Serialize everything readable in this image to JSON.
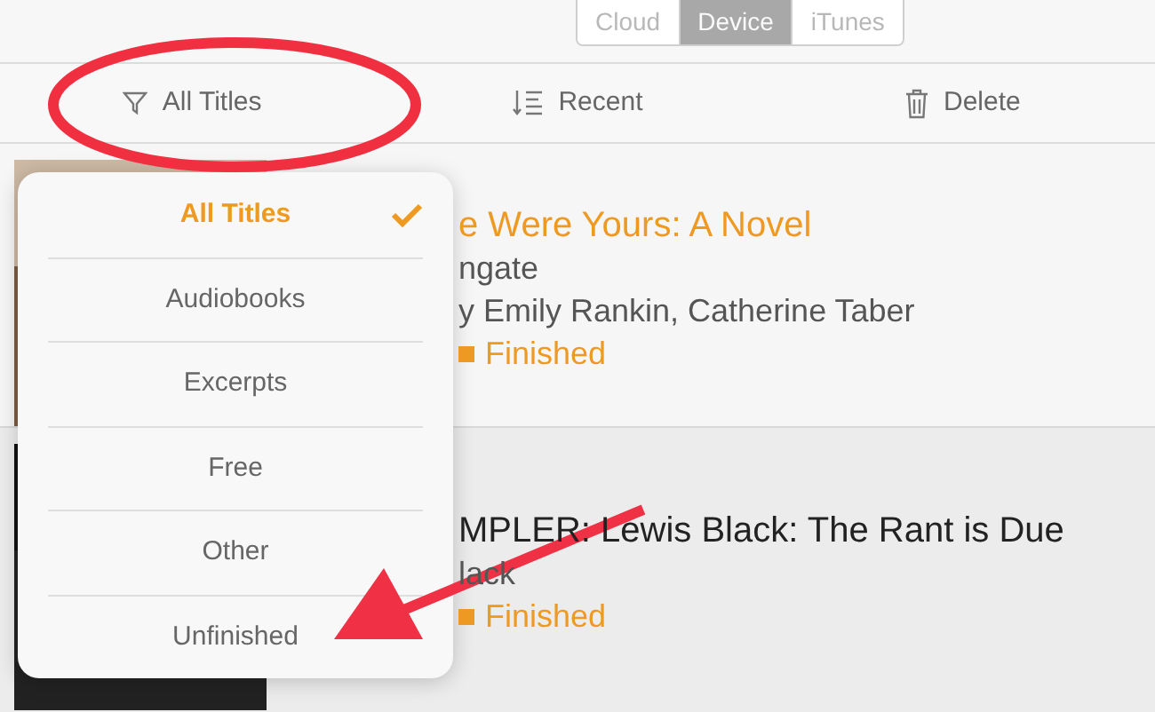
{
  "segments": [
    {
      "label": "Cloud",
      "selected": false
    },
    {
      "label": "Device",
      "selected": true
    },
    {
      "label": "iTunes",
      "selected": false
    }
  ],
  "toolbar": [
    {
      "kind": "filter",
      "label": "All Titles"
    },
    {
      "kind": "sort",
      "label": "Recent"
    },
    {
      "kind": "delete",
      "label": "Delete"
    }
  ],
  "books": [
    {
      "title": "e Were Yours: A Novel",
      "title_highlighted": true,
      "line_2": "ngate",
      "line_3": "y Emily Rankin, Catherine Taber",
      "status": "Finished"
    },
    {
      "title": "MPLER: Lewis Black: The Rant is Due",
      "title_highlighted": false,
      "line_2": "lack",
      "status": "Finished"
    }
  ],
  "filter_menu": [
    {
      "label": "All Titles",
      "selected": true
    },
    {
      "label": "Audiobooks",
      "selected": false
    },
    {
      "label": "Excerpts",
      "selected": false
    },
    {
      "label": "Free",
      "selected": false
    },
    {
      "label": "Other",
      "selected": false
    },
    {
      "label": "Unfinished",
      "selected": false
    }
  ]
}
